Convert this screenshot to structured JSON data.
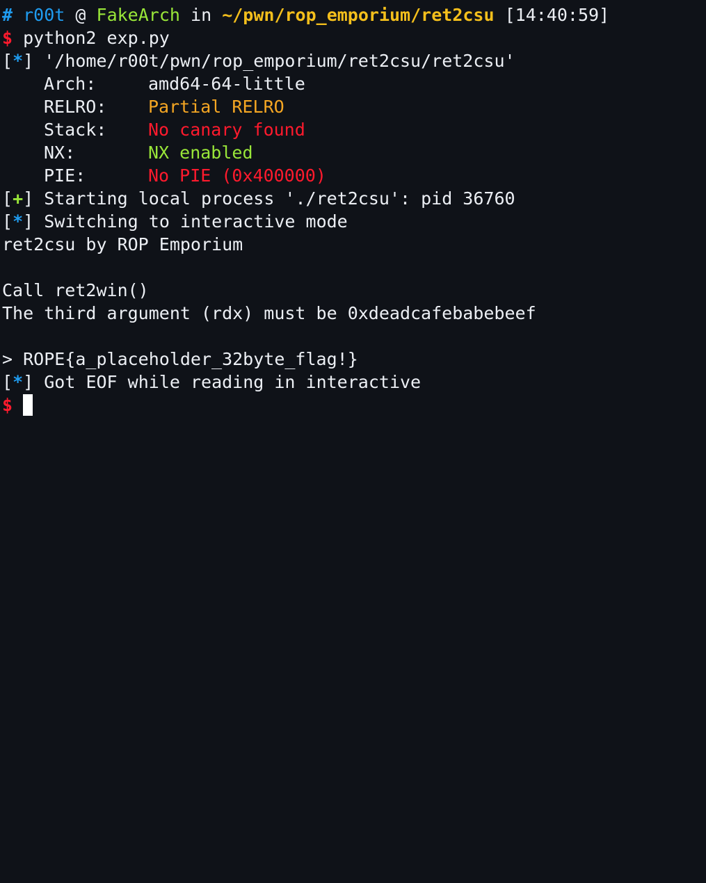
{
  "prompt": {
    "hash": "#",
    "user": "r00t",
    "at": "@",
    "host": "FakeArch",
    "in": "in",
    "path": "~/pwn/rop_emporium/ret2csu",
    "time": "[14:40:59]",
    "dollar": "$"
  },
  "command": "python2 exp.py",
  "checksec": {
    "path_line": "'/home/r00t/pwn/rop_emporium/ret2csu/ret2csu'",
    "rows": [
      {
        "key": "Arch:",
        "value": "amd64-64-little"
      },
      {
        "key": "RELRO:",
        "value": "Partial RELRO"
      },
      {
        "key": "Stack:",
        "value": "No canary found"
      },
      {
        "key": "NX:",
        "value": "NX enabled"
      },
      {
        "key": "PIE:",
        "value": "No PIE (0x400000)"
      }
    ]
  },
  "markers": {
    "star": "*",
    "plus": "+",
    "open": "[",
    "close": "]"
  },
  "log": {
    "starting": "Starting local process './ret2csu': pid 36760",
    "switching": "Switching to interactive mode",
    "banner": "ret2csu by ROP Emporium",
    "call": "Call ret2win()",
    "third_arg": "The third argument (rdx) must be 0xdeadcafebabebeef",
    "flag_line": "> ROPE{a_placeholder_32byte_flag!}",
    "eof": "Got EOF while reading in interactive"
  },
  "colors": {
    "background": "#0f1218",
    "info": "#1f9cf0",
    "success": "#99e639",
    "path": "#f4bf1c",
    "error": "#ff1a2d",
    "warning": "#f5a623"
  }
}
